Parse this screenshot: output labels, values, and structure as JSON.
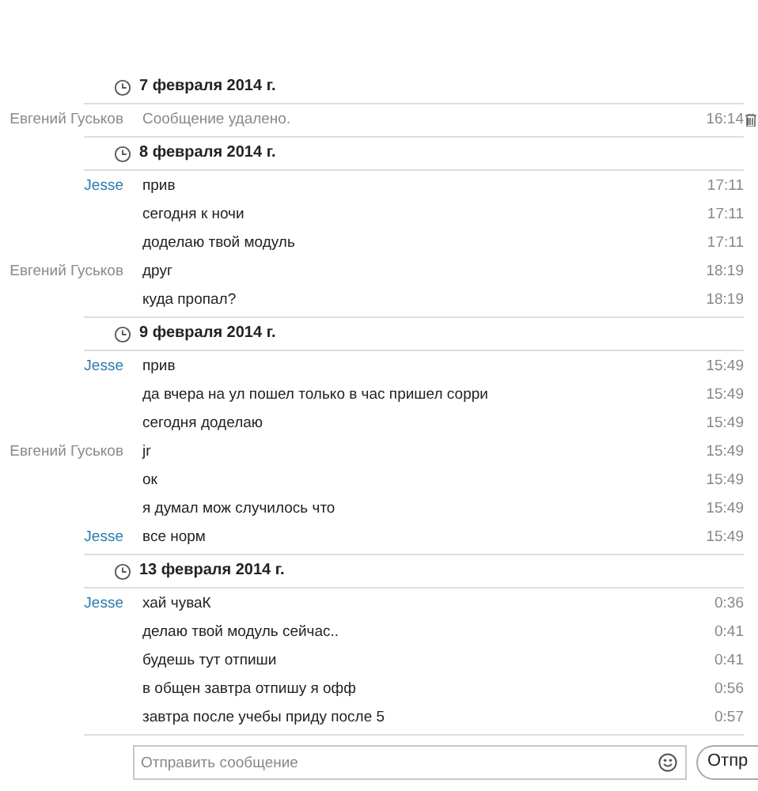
{
  "days": [
    {
      "date": "7 февраля 2014 г.",
      "messages": [
        {
          "sender": "Евгений Гуськов",
          "color": "#8a8a8a",
          "text": "Сообщение удалено.",
          "time": "16:14",
          "deleted": true
        }
      ]
    },
    {
      "date": "8 февраля 2014 г.",
      "messages": [
        {
          "sender": "Jesse",
          "color": "#2a7ab0",
          "text": "прив",
          "time": "17:11",
          "deleted": false
        },
        {
          "text": "сегодня к ночи",
          "time": "17:11",
          "deleted": false
        },
        {
          "text": "доделаю твой модуль",
          "time": "17:11",
          "deleted": false
        },
        {
          "sender": "Евгений Гуськов",
          "color": "#8a8a8a",
          "text": "друг",
          "time": "18:19",
          "deleted": false
        },
        {
          "text": "куда пропал?",
          "time": "18:19",
          "deleted": false
        }
      ]
    },
    {
      "date": "9 февраля 2014 г.",
      "messages": [
        {
          "sender": "Jesse",
          "color": "#2a7ab0",
          "text": "прив",
          "time": "15:49",
          "deleted": false
        },
        {
          "text": "да вчера на ул пошел только в час пришел сорри",
          "time": "15:49",
          "deleted": false
        },
        {
          "text": "сегодня доделаю",
          "time": "15:49",
          "deleted": false
        },
        {
          "sender": "Евгений Гуськов",
          "color": "#8a8a8a",
          "text": "jr",
          "time": "15:49",
          "deleted": false
        },
        {
          "text": "ок",
          "time": "15:49",
          "deleted": false
        },
        {
          "text": "я думал мож случилось что",
          "time": "15:49",
          "deleted": false
        },
        {
          "sender": "Jesse",
          "color": "#2a7ab0",
          "text": "все норм",
          "time": "15:49",
          "deleted": false
        }
      ]
    },
    {
      "date": "13 февраля 2014 г.",
      "messages": [
        {
          "sender": "Jesse",
          "color": "#2a7ab0",
          "text": "хай чуваК",
          "time": "0:36",
          "deleted": false
        },
        {
          "text": "делаю твой модуль сейчас..",
          "time": "0:41",
          "deleted": false
        },
        {
          "text": "будешь тут отпиши",
          "time": "0:41",
          "deleted": false
        },
        {
          "text": "в общен завтра отпишу я офф",
          "time": "0:56",
          "deleted": false
        },
        {
          "text": "завтра после учебы приду после 5",
          "time": "0:57",
          "deleted": false
        }
      ]
    }
  ],
  "composer": {
    "placeholder": "Отправить сообщение",
    "send_button": "Отпр"
  }
}
